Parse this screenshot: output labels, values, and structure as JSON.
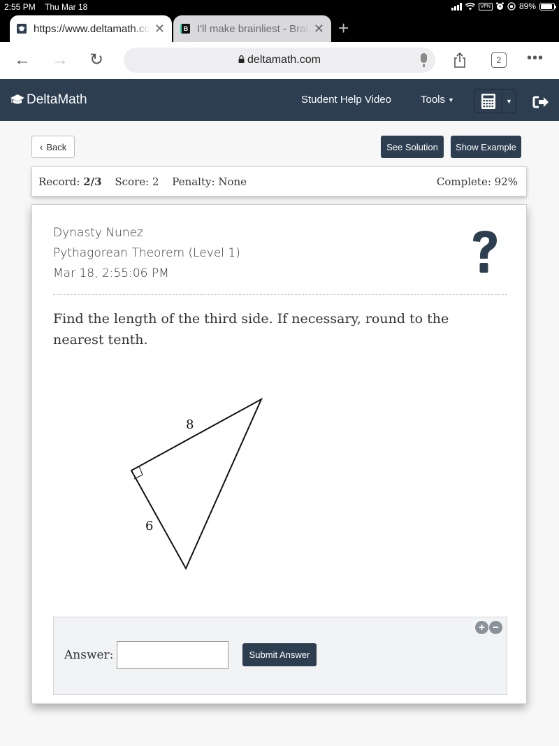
{
  "status_bar": {
    "time": "2:55 PM",
    "date": "Thu Mar 18",
    "vpn": "VPN",
    "battery": "89%",
    "battery_level": 0.89
  },
  "browser": {
    "tabs": [
      {
        "title": "https://www.deltamath.com",
        "active": true,
        "favicon": "deltamath-cap"
      },
      {
        "title": "I'll make brainliest - Brainly",
        "active": false,
        "favicon": "B"
      }
    ],
    "new_tab": "+",
    "close_glyph": "✕",
    "url": "deltamath.com",
    "tab_count": "2",
    "more_glyph": "•••",
    "back_glyph": "←",
    "forward_glyph": "→",
    "reload_glyph": "↻",
    "lock_glyph": "🔒"
  },
  "navbar": {
    "brand": "DeltaMath",
    "help_link": "Student Help Video",
    "tools_menu": "Tools",
    "caret": "▼"
  },
  "actions": {
    "back": "Back",
    "back_glyph": "‹",
    "see_solution": "See Solution",
    "show_example": "Show Example"
  },
  "record": {
    "record_label": "Record:",
    "record_value": "2/3",
    "score_label": "Score:",
    "score_value": "2",
    "penalty_label": "Penalty:",
    "penalty_value": "None",
    "complete_label": "Complete:",
    "complete_value": "92%"
  },
  "problem": {
    "student": "Dynasty Nunez",
    "topic": "Pythagorean Theorem (Level 1)",
    "timestamp": "Mar 18, 2:55:06 PM",
    "prompt": "Find the length of the third side. If necessary, round to the nearest tenth.",
    "figure": {
      "shape": "right-triangle",
      "legs": [
        {
          "label": "8"
        },
        {
          "label": "6"
        }
      ],
      "right_angle_marked": true
    }
  },
  "answer": {
    "label": "Answer:",
    "value": "",
    "placeholder": "",
    "submit": "Submit Answer",
    "zoom_in": "+",
    "zoom_out": "−"
  }
}
